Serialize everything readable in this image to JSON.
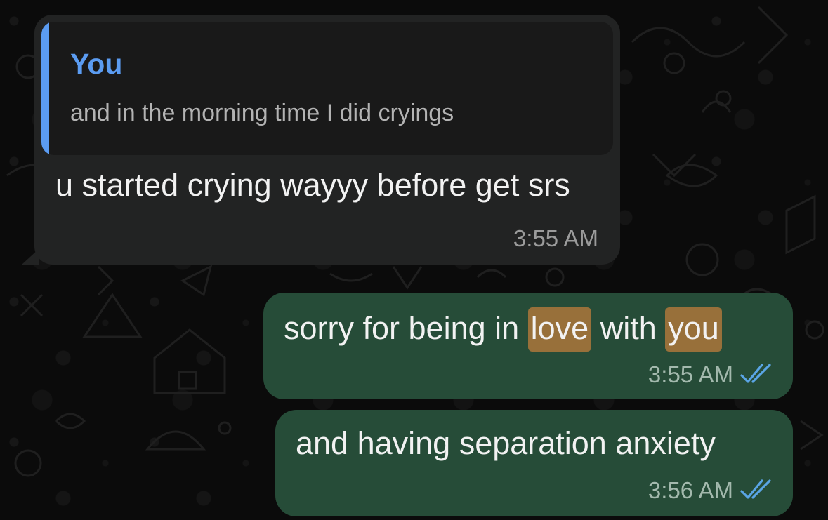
{
  "chat": {
    "messages": [
      {
        "direction": "incoming",
        "reply_to": {
          "author": "You",
          "text": "and in the morning time I did cryings"
        },
        "text": "u started crying wayyy before get srs",
        "time": "3:55 AM"
      },
      {
        "direction": "outgoing",
        "segments": [
          "sorry for being in ",
          "love",
          " with ",
          "you"
        ],
        "highlighted": [
          "love",
          "you"
        ],
        "time": "3:55 AM",
        "status": "read"
      },
      {
        "direction": "outgoing",
        "text": "and having separation anxiety",
        "time": "3:56 AM",
        "status": "read"
      }
    ]
  },
  "colors": {
    "background": "#0b0b0b",
    "incoming_bubble": "#222323",
    "outgoing_bubble": "#264c38",
    "quote_accent": "#5b9cf2",
    "search_highlight": "#98703a",
    "read_ticks": "#5aa5e6"
  },
  "icons": {
    "read_receipt": "double-check-icon"
  }
}
